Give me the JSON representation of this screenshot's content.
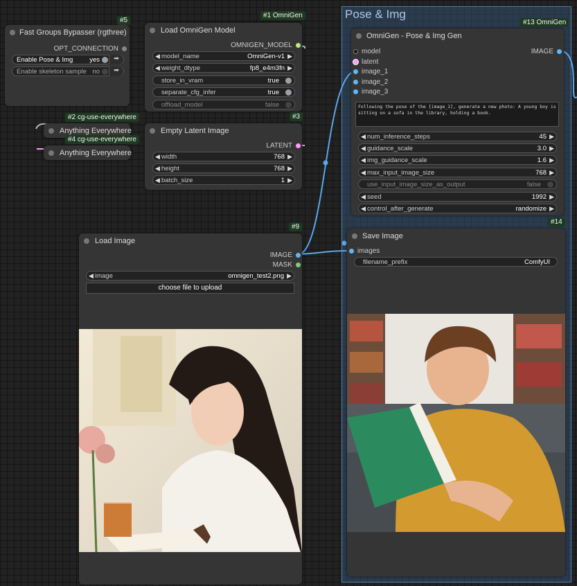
{
  "group": {
    "title": "Pose & Img"
  },
  "nodes": {
    "bypasser": {
      "badge": "#5",
      "title": "Fast Groups Bypasser (rgthree)",
      "output": "OPT_CONNECTION",
      "rows": [
        {
          "label": "Enable Pose & Img",
          "value": "yes",
          "nav_icon": "arrow-right-icon"
        },
        {
          "label": "Enable skeleton sample",
          "value": "no",
          "nav_icon": "arrow-right-icon"
        }
      ]
    },
    "loadModel": {
      "badge": "#1 OmniGen",
      "title": "Load OmniGen Model",
      "output": "OMNIGEN_MODEL",
      "widgets": [
        {
          "label": "model_name",
          "value": "OmniGen-v1"
        },
        {
          "label": "weight_dtype",
          "value": "fp8_e4m3fn"
        },
        {
          "label": "store_in_vram",
          "value": "true"
        },
        {
          "label": "separate_cfg_infer",
          "value": "true"
        },
        {
          "label": "offload_model",
          "value": "false"
        }
      ]
    },
    "anything2": {
      "badge": "#2 cg-use-everywhere",
      "title": "Anything Everywhere"
    },
    "anything4": {
      "badge": "#4 cg-use-everywhere",
      "title": "Anything Everywhere"
    },
    "latent": {
      "badge": "#3",
      "title": "Empty Latent Image",
      "output": "LATENT",
      "widgets": [
        {
          "label": "width",
          "value": "768"
        },
        {
          "label": "height",
          "value": "768"
        },
        {
          "label": "batch_size",
          "value": "1"
        }
      ]
    },
    "loadImage": {
      "badge": "#9",
      "title": "Load Image",
      "outputs": [
        "IMAGE",
        "MASK"
      ],
      "image_label": "image",
      "image_value": "omnigen_test2.png",
      "upload_label": "choose file to upload"
    },
    "omnigen": {
      "badge": "#13 OmniGen",
      "title": "OmniGen - Pose & Img Gen",
      "inputs": [
        "model",
        "latent",
        "image_1",
        "image_2",
        "image_3"
      ],
      "output": "IMAGE",
      "prompt": "Following the pose of the [image_1], generate a new photo: A young boy is sitting on a sofa in the library, holding a book.",
      "widgets": [
        {
          "label": "num_inference_steps",
          "value": "45"
        },
        {
          "label": "guidance_scale",
          "value": "3.0"
        },
        {
          "label": "img_guidance_scale",
          "value": "1.6"
        },
        {
          "label": "max_input_image_size",
          "value": "768"
        },
        {
          "label": "use_input_image_size_as_output",
          "value": "false"
        },
        {
          "label": "seed",
          "value": "1992"
        },
        {
          "label": "control_after_generate",
          "value": "randomize"
        }
      ]
    },
    "saveImage": {
      "badge": "#14",
      "title": "Save Image",
      "input": "images",
      "widget": {
        "label": "filename_prefix",
        "value": "ComfyUI"
      }
    }
  },
  "colors": {
    "image_slot": "#64b5f6",
    "latent_slot": "#ff9cf9",
    "model_slot": "#b8e986",
    "mask_slot": "#81c784",
    "wire_image": "#5aa8ec",
    "wire_latent": "#ff9cf9",
    "badge_bg": "#1e3a22"
  }
}
